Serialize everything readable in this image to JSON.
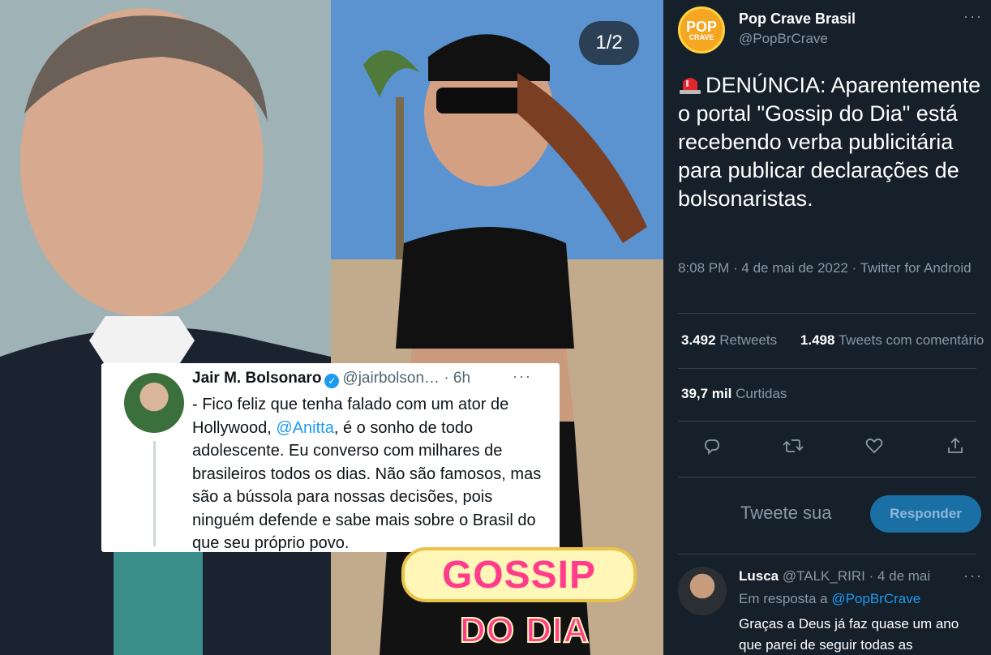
{
  "media": {
    "counter": "1/2",
    "embedded_tweet": {
      "name": "Jair M. Bolsonaro",
      "handle": "@jairbolson…",
      "time": "· 6h",
      "text_before": "- Fico feliz que tenha falado com um ator de Hollywood, ",
      "mention": "@Anitta",
      "text_after": ", é o sonho de todo adolescente. Eu converso com milhares de brasileiros todos os dias. Não são famosos, mas são a bússola para nossas decisões, pois ninguém defende e sabe mais sobre o Brasil do que seu próprio povo."
    },
    "logo": {
      "line1": "GOSSIP",
      "line2": "DO DIA"
    }
  },
  "tweet": {
    "author_name": "Pop Crave Brasil",
    "author_handle": "@PopBrCrave",
    "avatar_text_top": "POP",
    "avatar_text_bottom": "CRAVE",
    "text": "DENÚNCIA: Aparentemente o portal \"Gossip do Dia\" está recebendo verba publicitária para publicar declarações de bolsonaristas.",
    "meta": "8:08 PM · 4 de mai de 2022 · Twitter for Android",
    "retweets_count": "3.492",
    "retweets_label": "Retweets",
    "quotes_count": "1.498",
    "quotes_label": "Tweets com comentário",
    "likes_count": "39,7 mil",
    "likes_label": "Curtidas"
  },
  "compose": {
    "placeholder": "Tweete sua",
    "button": "Responder"
  },
  "reply": {
    "name": "Lusca",
    "handle": "@TALK_RIRI",
    "date": "· 4 de mai",
    "context_prefix": "Em resposta a ",
    "context_mention": "@PopBrCrave",
    "text": "Graças a Deus já faz quase um ano que parei de seguir todas as"
  },
  "colors": {
    "panel_bg": "#15202b",
    "accent": "#1d9bf0",
    "secondary_text": "#8899a6",
    "gossip_pink": "#ff3d8b"
  },
  "icons": [
    "siren-icon",
    "more-icon",
    "reply-icon",
    "retweet-icon",
    "like-icon",
    "share-icon",
    "verified-icon"
  ]
}
